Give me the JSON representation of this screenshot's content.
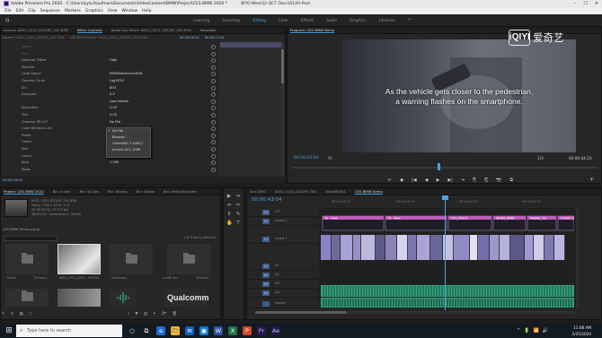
{
  "window": {
    "title": "Adobe Premiere Pro 2020 - C:\\Users\\Lyla.Kaufman\\Documents\\VideoContent\\BMW\\Project\\CES BMW 2020 *",
    "clip_title": "WYO-West32-QCT Own101X0-Post",
    "controls": [
      "–",
      "☐",
      "✕"
    ]
  },
  "menu": [
    "File",
    "Edit",
    "Clip",
    "Sequence",
    "Markers",
    "Graphics",
    "View",
    "Window",
    "Help"
  ],
  "workspaces": {
    "tabs": [
      "Learning",
      "Assembly",
      "Editing",
      "Color",
      "Effects",
      "Audio",
      "Graphics",
      "Libraries"
    ],
    "active": "Editing",
    "more": "»"
  },
  "effect_panel": {
    "tabs": [
      "Source: A001_C021_0202SF_001.R3D",
      "Effect Controls",
      "Audio Clip Mixer: A001_C021_0202SF_001.R3D",
      "Metadata"
    ],
    "active_tab": "Effect Controls",
    "sub": {
      "master": "Master * A001_C021_0202SF_001.R3D",
      "seq": "CES BMW Demo * A001_C021_0202SF_001.R3D",
      "timecode_a": "00:43:16:12",
      "timecode_b": "00:43:17:02"
    },
    "rows": [
      {
        "label": "Kelvin",
        "value": "",
        "dim": true
      },
      {
        "label": "Tint",
        "value": "",
        "dim": true
      },
      {
        "label": "Detector Offset",
        "value": "High"
      },
      {
        "label": "Pipeline",
        "value": ""
      },
      {
        "label": "Color Space",
        "value": "REDWideGamutRGB"
      },
      {
        "label": "Gamma Curve",
        "value": "Log3G10"
      },
      {
        "label": "ISO",
        "value": "800"
      },
      {
        "label": "Exposure",
        "value": "0.0"
      },
      {
        "label": "",
        "value": "Load Admin"
      },
      {
        "label": "Saturation",
        "value": "1.00"
      },
      {
        "label": "Tint",
        "value": "0.00"
      },
      {
        "label": "Creative 3D LUT",
        "value": "No File"
      },
      {
        "label": "Color Decision List",
        "value": ""
      },
      {
        "label": "Power",
        "value": ""
      },
      {
        "label": "Green",
        "value": "1.000"
      },
      {
        "label": "Red",
        "value": "1.000"
      },
      {
        "label": "Green",
        "value": "1.000"
      },
      {
        "label": "Blue",
        "value": "1.000"
      },
      {
        "label": "Slope",
        "value": ""
      }
    ],
    "dropdown": [
      "No File",
      "Browse...",
      "CXrec600-7-140G1",
      "Junior3-001-100R"
    ],
    "footer_timecode": "00:43:43:04"
  },
  "program": {
    "tab": "Program: CES BMW Demo",
    "subtitle_line1": "As the vehicle gets closer to the pedestrian,",
    "subtitle_line2": "a warning flashes on the smartphone.",
    "timecode": "00:00:43:04",
    "fit": "Fit",
    "quality": "1/4",
    "duration": "00:00:44:23",
    "transport": [
      "⇤",
      "◆",
      "|◀",
      "◀",
      "▶",
      "▶|",
      "⇥",
      "⎘",
      "⎗",
      "📷",
      "⧉"
    ],
    "add": "+"
  },
  "watermark": {
    "logo": "iQIYI",
    "text": "爱奇艺"
  },
  "project": {
    "tabs": [
      "Project: CES BMW 2020",
      "Bin: a cam",
      "Bin: B Cam",
      "Bin: Sharon",
      "Bin: Drone",
      "Bin: Media Encoder"
    ],
    "active_tab": "Project: CES BMW 2020",
    "clip_info": [
      "A001_C021_0202SF_001.R3D",
      "Video, 5760 x 3240 (1.0)",
      "00:00:43:04, 23.976 fps",
      "48000 Hz - Compressed - Stereo"
    ],
    "project_name": "CES BMW Demo.prproj",
    "item_count": "1 of 8 items selected",
    "bins": [
      {
        "label": "Drone",
        "count": "20 Items"
      },
      {
        "label": "A001_C021_0202...",
        "count": "0:43:04"
      },
      {
        "label": "Interviews",
        "count": ""
      },
      {
        "label": "b roll",
        "count": "2 items"
      },
      {
        "label": "B Cam",
        "count": "18 Items"
      }
    ],
    "row2": [
      "",
      "",
      "",
      "Qualcomm",
      ""
    ],
    "qualcomm": "Qualcomm",
    "footer_icons": [
      "✎",
      "≡",
      "▦",
      "○",
      "⌕",
      "▼",
      "▤",
      "✦",
      "🗁",
      "🗑"
    ]
  },
  "tools": [
    "▶",
    "↔",
    "⇔",
    "✂",
    "↕",
    "✎",
    "✋",
    "T"
  ],
  "timeline": {
    "tabs": [
      "Sch 0000",
      "A001_C041_0202SF_001",
      "ExtraB0001",
      "CES BMW Demo"
    ],
    "active_tab": "CES BMW Demo",
    "timecode": "00:00:43:04",
    "ruler": [
      "00:00:14:23",
      "00:00:29:23",
      "00:00:44:22",
      "00:00:59:22"
    ],
    "tracks": [
      {
        "target": "V3",
        "name": "V3"
      },
      {
        "target": "V2",
        "name": "Video 2"
      },
      {
        "target": "V1",
        "name": "Video 1"
      },
      {
        "target": "A1",
        "name": "A1"
      },
      {
        "target": "A2",
        "name": "A2"
      },
      {
        "target": "A3",
        "name": "A3"
      },
      {
        "target": "A4",
        "name": "A4"
      },
      {
        "target": "",
        "name": "Master"
      }
    ],
    "v2_labels": [
      "fx - Fwd",
      "fx - Bkw",
      "CES_Mdmt",
      "WhBlt_BMW",
      "Mobile_ver",
      "Fwdmr_01"
    ]
  },
  "taskbar": {
    "start": "⊞",
    "search_placeholder": "Type here to search",
    "apps": [
      "○",
      "⧉",
      "e",
      "🗁",
      "✉",
      "▣",
      "W",
      "X",
      "P",
      "Pr",
      "Ae"
    ],
    "tray": [
      "^",
      "🔋",
      "📶",
      "🔊"
    ],
    "time": "11:08 AM",
    "date": "2/25/2020"
  },
  "colors": {
    "accent": "#4aa3df",
    "panel": "#262626",
    "audio_clip": "#1f7a5c",
    "video_clip": "#8b83c7"
  }
}
